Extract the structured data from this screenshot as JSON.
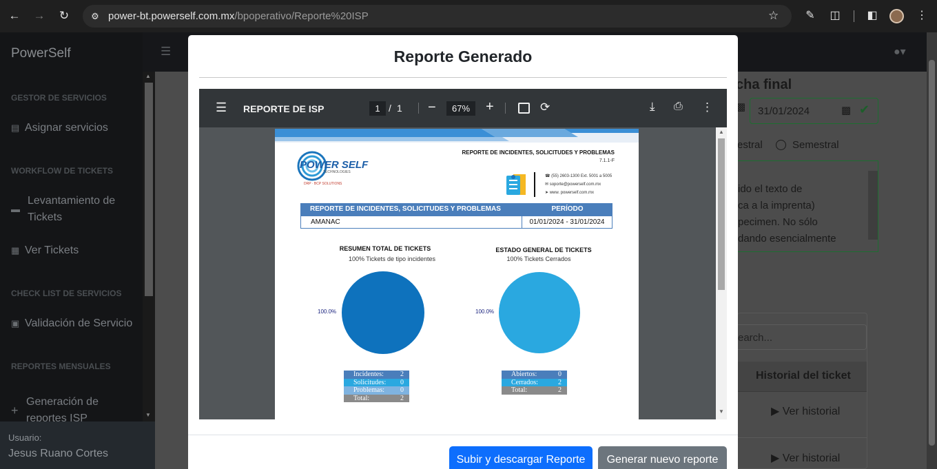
{
  "browser": {
    "url_host": "power-bt.powerself.com.mx",
    "url_path": "/bpoperativo/Reporte%20ISP"
  },
  "app": {
    "brand": "PowerSelf",
    "sidebar": {
      "sections": [
        {
          "title": "GESTOR DE SERVICIOS",
          "items": [
            "Asignar servicios"
          ]
        },
        {
          "title": "WORKFLOW DE TICKETS",
          "items": [
            "Levantamiento de Tickets",
            "Ver Tickets"
          ]
        },
        {
          "title": "CHECK LIST DE SERVICIOS",
          "items": [
            "Validación de Servicio"
          ]
        },
        {
          "title": "REPORTES MENSUALES",
          "items": [
            "Generación de reportes ISP"
          ]
        }
      ],
      "user_label": "Usuario:",
      "user_name": "Jesus Ruano Cortes"
    },
    "background": {
      "fecha_final_label": "cha final",
      "fecha_final_value": "31/01/2024",
      "radio_left": "estral",
      "radio_right": "Semestral",
      "textarea_lines": [
        "ido el texto de",
        "ca a la imprenta)",
        "pecimen. No sólo",
        "dando esencialmente"
      ],
      "search_placeholder": "earch...",
      "col_header": "Historial del ticket",
      "row_action": "Ver historial"
    }
  },
  "modal": {
    "title": "Reporte Generado",
    "viewer": {
      "doc_title": "REPORTE DE ISP",
      "page_current": "1",
      "page_sep": "/",
      "page_total": "1",
      "zoom": "67%"
    },
    "pdf": {
      "header_title": "REPORTE DE INCIDENTES,  SOLICITUDES Y PROBLEMAS",
      "header_code": "7.1.1-F",
      "logo_main": "POWER SELF",
      "logo_sub": "TECHNOLOGIES",
      "logo_tag": "DRP · BCP SOLUTIONS",
      "contact_phone": "(55) 2603-1300 Ext. 5001 a 5005",
      "contact_email": "soporte@powerself.com.mx",
      "contact_web": "www. powerself.com.mx",
      "table_col1": "REPORTE DE INCIDENTES, SOLICITUDES Y PROBLEMAS",
      "table_col2": "PERÍODO",
      "table_client": "AMANAC",
      "table_period": "01/01/2024 - 31/01/2024",
      "chart1": {
        "title": "RESUMEN TOTAL DE TICKETS",
        "subtitle": "100% Tickets de tipo incidentes",
        "pct_label": "100.0%",
        "color": "#0e72bd",
        "legend": [
          {
            "label": "Incidentes:",
            "value": "2"
          },
          {
            "label": "Solicitudes:",
            "value": "0"
          },
          {
            "label": "Problemas:",
            "value": "0"
          },
          {
            "label": "Total:",
            "value": "2"
          }
        ]
      },
      "chart2": {
        "title": "ESTADO GENERAL DE TICKETS",
        "subtitle": "100% Tickets Cerrados",
        "pct_label": "100.0%",
        "color": "#2aa8e0",
        "legend": [
          {
            "label": "Abiertos:",
            "value": "0"
          },
          {
            "label": "Cerrados:",
            "value": "2"
          },
          {
            "label": "Total:",
            "value": "2"
          }
        ]
      }
    },
    "buttons": {
      "upload": "Subir y descargar Reporte",
      "generate": "Generar nuevo reporte"
    }
  },
  "chart_data": [
    {
      "type": "pie",
      "title": "RESUMEN TOTAL DE TICKETS",
      "subtitle": "100% Tickets de tipo incidentes",
      "categories": [
        "Incidentes",
        "Solicitudes",
        "Problemas"
      ],
      "values": [
        2,
        0,
        0
      ]
    },
    {
      "type": "pie",
      "title": "ESTADO GENERAL DE TICKETS",
      "subtitle": "100% Tickets Cerrados",
      "categories": [
        "Abiertos",
        "Cerrados"
      ],
      "values": [
        0,
        2
      ]
    }
  ]
}
